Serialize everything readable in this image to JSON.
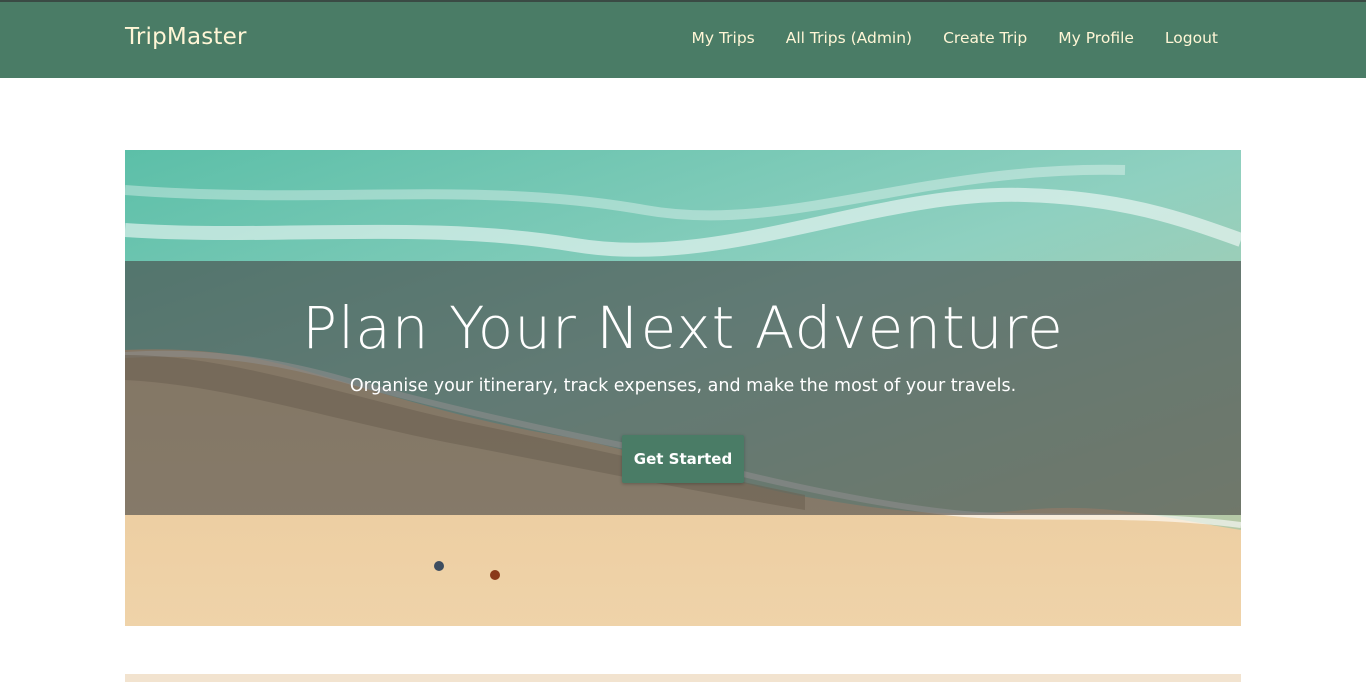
{
  "navbar": {
    "brand": "TripMaster",
    "links": [
      {
        "label": "My Trips"
      },
      {
        "label": "All Trips (Admin)"
      },
      {
        "label": "Create Trip"
      },
      {
        "label": "My Profile"
      },
      {
        "label": "Logout"
      }
    ]
  },
  "hero": {
    "image": "beach-aerial-image",
    "title": "Plan Your Next Adventure",
    "subtitle": "Organise your itinerary, track expenses, and make the most of your travels.",
    "cta_label": "Get Started"
  },
  "colors": {
    "primary": "#4a7c66",
    "nav_text": "#fff6d6",
    "overlay": "#464646"
  }
}
